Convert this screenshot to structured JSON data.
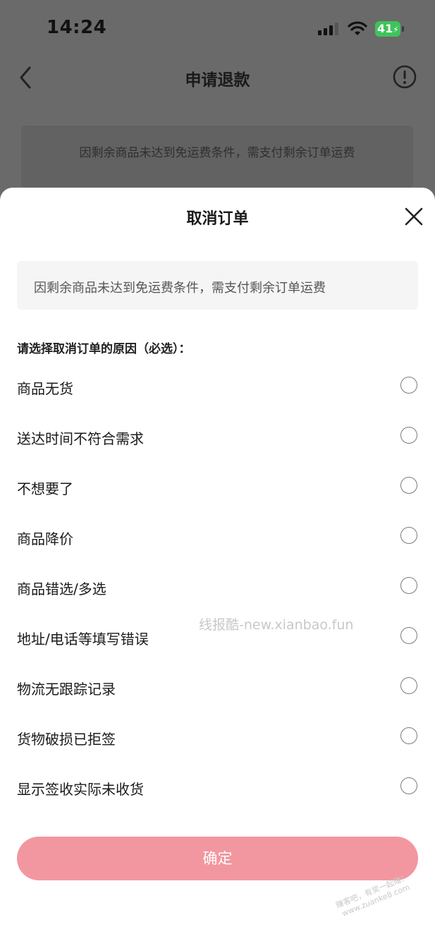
{
  "status_bar": {
    "time": "14:24",
    "battery": "41"
  },
  "nav": {
    "title": "申请退款"
  },
  "background_notice": "因剩余商品未达到免运费条件，需支付剩余订单运费",
  "sheet": {
    "title": "取消订单",
    "notice": "因剩余商品未达到免运费条件，需支付剩余订单运费",
    "prompt": "请选择取消订单的原因（必选）：",
    "reasons": [
      {
        "label": "商品无货"
      },
      {
        "label": "送达时间不符合需求"
      },
      {
        "label": "不想要了"
      },
      {
        "label": "商品降价"
      },
      {
        "label": "商品错选/多选"
      },
      {
        "label": "地址/电话等填写错误"
      },
      {
        "label": "物流无跟踪记录"
      },
      {
        "label": "货物破损已拒签"
      },
      {
        "label": "显示签收实际未收货"
      }
    ],
    "confirm_label": "确定"
  },
  "watermark": "线报酷-new.xianbao.fun",
  "corner_stamp": "赚客吧，有奖一起赚！ www.zuanke8.com",
  "colors": {
    "confirm_bg": "#f2979f",
    "battery": "#3ec45a"
  }
}
